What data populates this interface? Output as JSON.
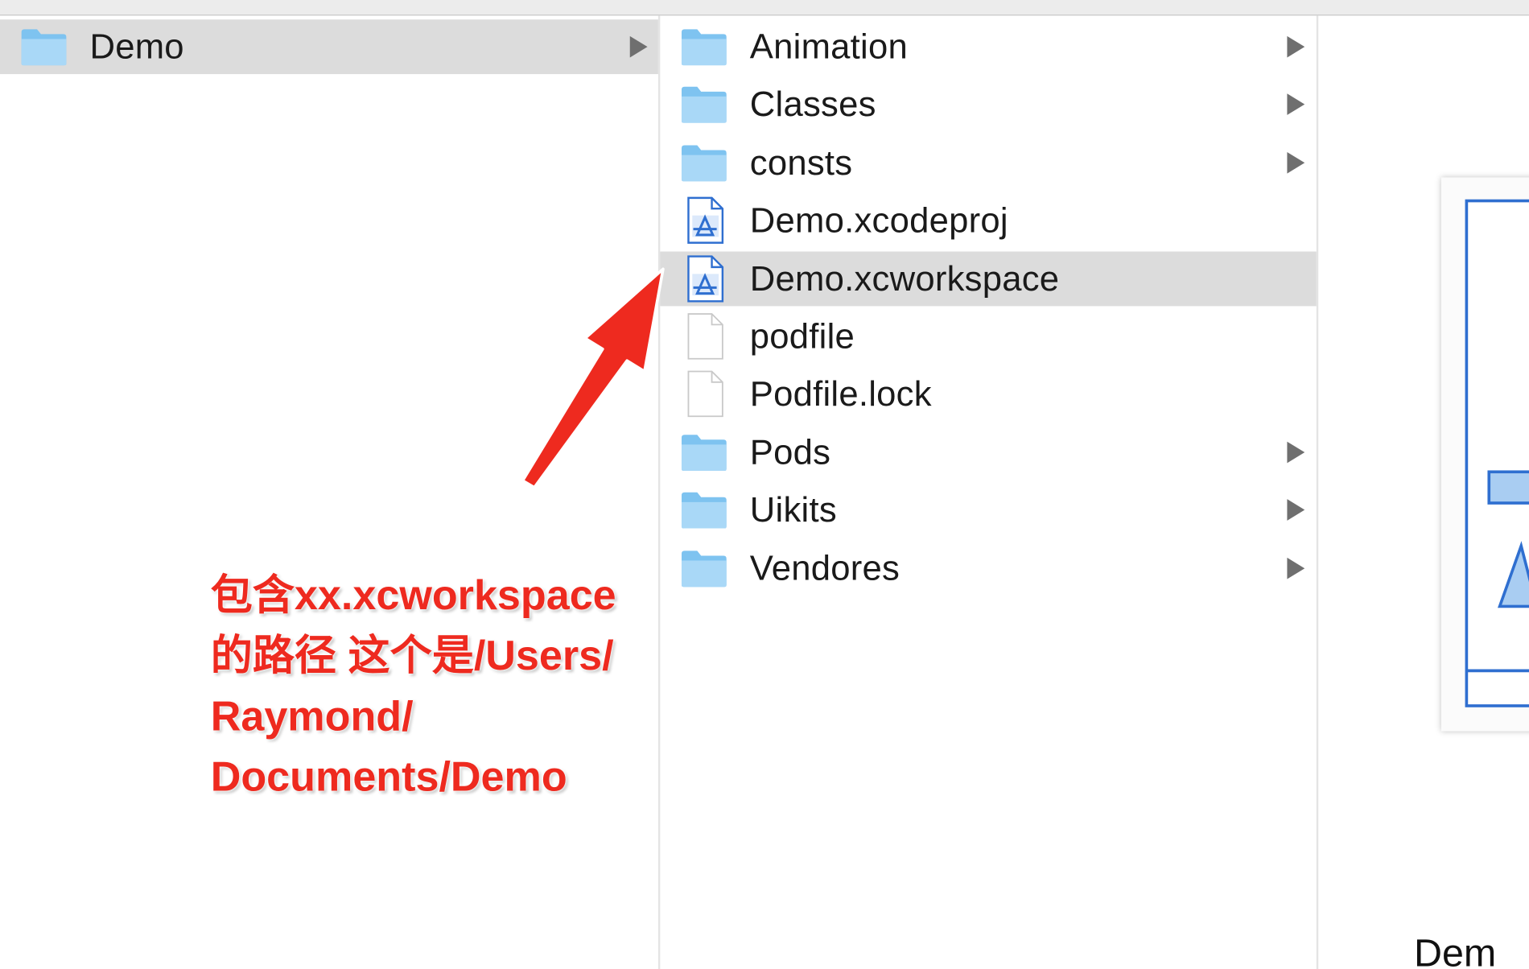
{
  "column1": {
    "items": [
      {
        "name": "Demo",
        "kind": "folder",
        "has_children": true,
        "selected": true
      }
    ]
  },
  "column2": {
    "items": [
      {
        "name": "Animation",
        "kind": "folder",
        "has_children": true
      },
      {
        "name": "Classes",
        "kind": "folder",
        "has_children": true
      },
      {
        "name": "consts",
        "kind": "folder",
        "has_children": true
      },
      {
        "name": "Demo.xcodeproj",
        "kind": "xcode",
        "has_children": false
      },
      {
        "name": "Demo.xcworkspace",
        "kind": "xcode",
        "has_children": false,
        "selected": true
      },
      {
        "name": "podfile",
        "kind": "file",
        "has_children": false
      },
      {
        "name": "Podfile.lock",
        "kind": "file",
        "has_children": false
      },
      {
        "name": "Pods",
        "kind": "folder",
        "has_children": true
      },
      {
        "name": "Uikits",
        "kind": "folder",
        "has_children": true
      },
      {
        "name": "Vendores",
        "kind": "folder",
        "has_children": true
      }
    ]
  },
  "preview": {
    "title": "Dem"
  },
  "annotation": {
    "lines": [
      "包含xx.xcworkspace",
      "的路径  这个是/Users/",
      "Raymond/",
      "Documents/Demo"
    ],
    "color": "#ee2a1f"
  },
  "icons": {
    "folder": "folder-icon",
    "xcode": "xcode-project-icon",
    "file": "document-icon",
    "chevron": "chevron-right-icon"
  },
  "colors": {
    "folder_light": "#a9d8f7",
    "folder_dark": "#7ec3f0",
    "selection": "#dcdcdc"
  }
}
